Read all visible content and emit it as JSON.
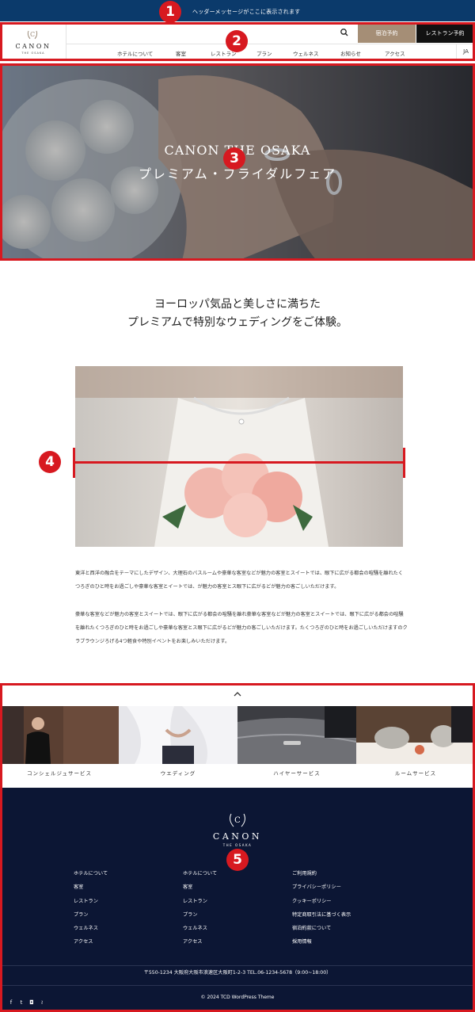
{
  "message_bar": {
    "text": "ヘッダーメッセージがここに表示されます"
  },
  "header": {
    "logo": {
      "name": "CANON",
      "sub": "THE OSAKA"
    },
    "search_icon": "search-icon",
    "stay_button": "宿泊予約",
    "restaurant_button": "レストラン予約",
    "nav": [
      "ホテルについて",
      "客室",
      "レストラン",
      "プラン",
      "ウェルネス",
      "お知らせ",
      "アクセス"
    ],
    "lang": "JA"
  },
  "hero": {
    "title_line1": "CANON THE OSAKA",
    "title_line2": "プレミアム・ブライダルフェア"
  },
  "intro": {
    "headline_line1": "ヨーロッパ気品と美しさに満ちた",
    "headline_line2": "プレミアムで特別なウェディングをご体験。",
    "paragraph1": "東洋と西洋の融合をテーマにしたデザイン、大理石のバスルームや豪華な客室などが魅力の客室とスイートでは、眼下に広がる都会の喧騒を離れたくつろぎのひと時をお過ごしや豪華な客室とイートでは、が魅力の客室とス眼下に広がるどが魅力の客ごしいただけます。",
    "paragraph2": "豪華な客室などが魅力の客室とスイートでは、眼下に広がる都会の喧騒を離れ豪華な客室などが魅力の客室とスイートでは、眼下に広がる都会の喧騒を離れたくつろぎのひと時をお過ごしや豪華な客室とス眼下に広がるどが魅力の客ごしいただけます。たくつろぎのひと時をお過ごしいただけますのクラブラウンジろげる4つ軽食や特別イベントをお楽しみいただけます。"
  },
  "services": [
    {
      "label": "コンシェルジュサービス"
    },
    {
      "label": "ウエディング"
    },
    {
      "label": "ハイヤーサービス"
    },
    {
      "label": "ルームサービス"
    }
  ],
  "footer": {
    "logo": {
      "name": "CANON",
      "sub": "THE OSAKA"
    },
    "col1": [
      "ホテルについて",
      "客室",
      "レストラン",
      "プラン",
      "ウェルネス",
      "アクセス"
    ],
    "col2": [
      "ホテルについて",
      "客室",
      "レストラン",
      "プラン",
      "ウェルネス",
      "アクセス"
    ],
    "col3": [
      "ご利用規約",
      "プライバシーポリシー",
      "クッキーポリシー",
      "特定商取引法に基づく表示",
      "宿泊約款について",
      "採用情報"
    ],
    "address": "〒550-1234  大阪府大阪市浪速区大阪町1-2-3     TEL.06-1234-5678（9:00~18:00）",
    "social": [
      "facebook-icon",
      "twitter-icon",
      "instagram-icon",
      "rss-icon"
    ],
    "copyright": "© 2024 TCD WordPress Theme"
  },
  "annotations": [
    "1",
    "2",
    "3",
    "4",
    "5"
  ],
  "colors": {
    "message_bar": "#0b3a6b",
    "stay_button": "#a58e76",
    "footer": "#0c1634",
    "annotation": "#d71920"
  }
}
